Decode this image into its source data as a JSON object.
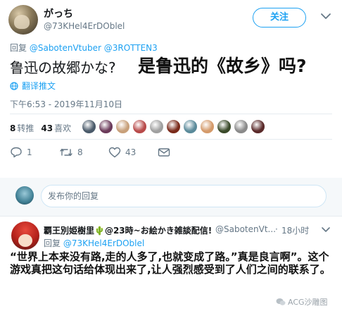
{
  "tweet": {
    "display_name": "がっち",
    "handle": "@73KHel4ErDOblel",
    "follow_label": "关注",
    "reply_prefix": "回复",
    "reply_mentions": "@SabotenVtuber @3ROTTEN3",
    "text": "鲁迅の故郷かな?",
    "translate_label": "翻译推文",
    "timestamp": "下午6:53 - 2019年11月10日",
    "retweet_count": "8",
    "retweet_label": "转推",
    "like_count": "43",
    "like_label": "喜欢",
    "action_reply_count": "1",
    "action_retweet_count": "8",
    "action_like_count": "43"
  },
  "overlay_caption": "是鲁迅的《故乡》吗?",
  "reply_box": {
    "placeholder": "发布你的回复"
  },
  "reply": {
    "display_name": "覇王別姫樹里🌵@23時~お絵かき雑談配信!",
    "handle": "@SabotenVt...",
    "separator": "·",
    "time": "18小时",
    "reply_prefix": "回复",
    "reply_mention": "@73KHel4ErDOblel",
    "text": "“世界上本来没有路,走的人多了,也就变成了路。”真是良言啊”。这个游戏真把这句话给体现出来了,让人强烈感受到了人们之间的联系了。"
  },
  "watermark": "ACG沙雕图",
  "liker_colors": [
    "#4a5a6a",
    "#6b3a5a",
    "#c8a07a",
    "#b84a4a",
    "#a0a0a0",
    "#7a2a1a",
    "#5a8a9a",
    "#d49a6a",
    "#3a4a2a",
    "#8a8a8a",
    "#5a2a2a"
  ],
  "colors": {
    "accent": "#1da1f2",
    "muted": "#657786",
    "text": "#14171a"
  }
}
